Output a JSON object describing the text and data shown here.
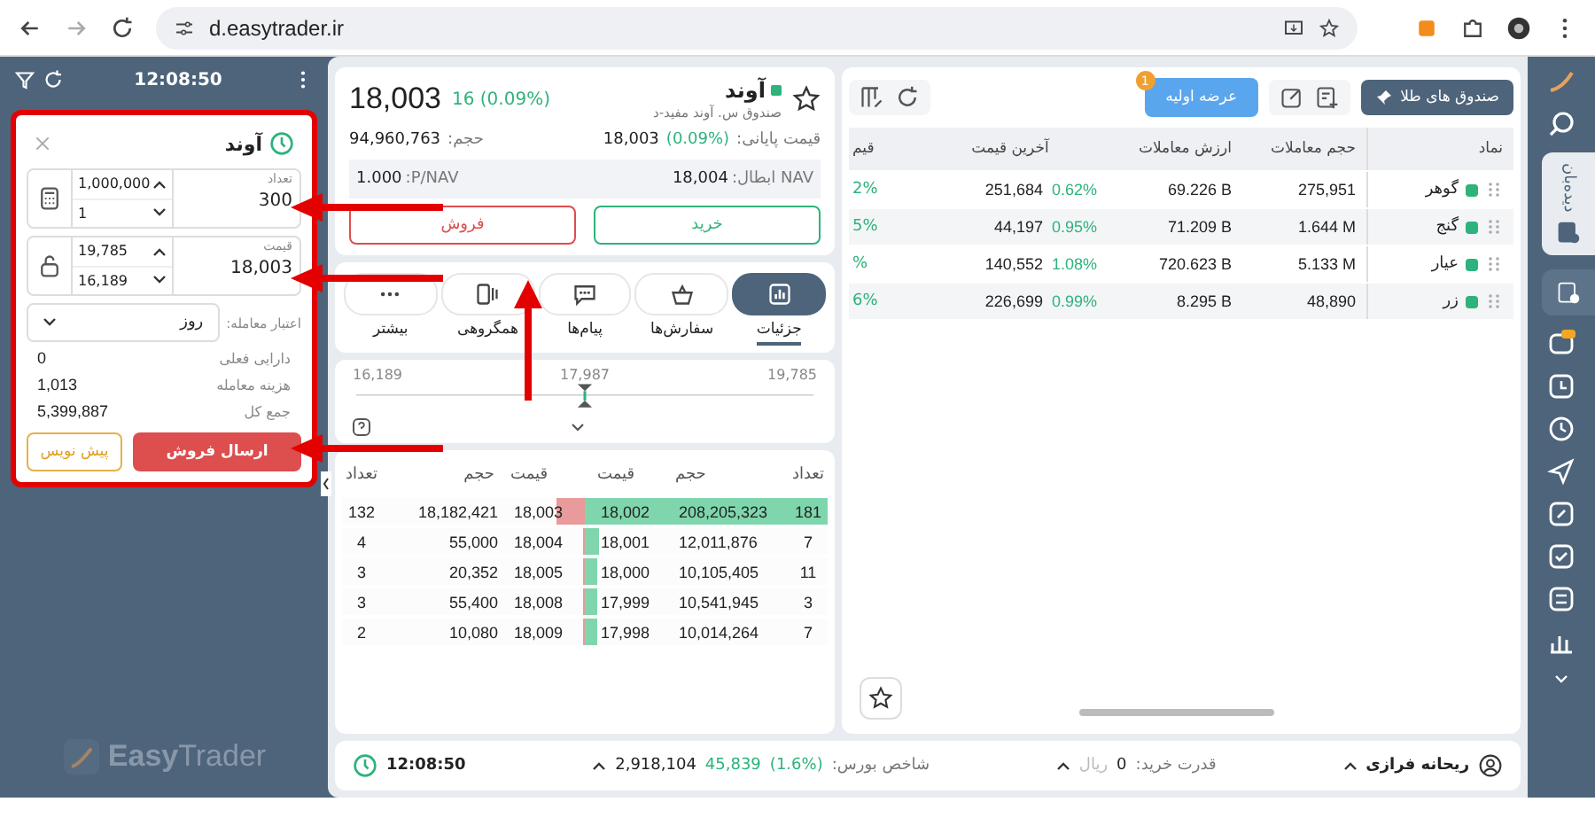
{
  "browser": {
    "url": "d.easytrader.ir"
  },
  "order_panel": {
    "time": "12:08:50",
    "title": "آوند",
    "fields": [
      {
        "kind": "count",
        "label": "تعداد",
        "value": "300",
        "upper": "1,000,000",
        "lower": "1"
      },
      {
        "kind": "price",
        "label": "قیمت",
        "value": "18,003",
        "upper": "19,785",
        "lower": "16,189"
      }
    ],
    "validity": {
      "label": "اعتبار معامله:",
      "value": "روز"
    },
    "summary": [
      {
        "label": "دارایی فعلی",
        "value": "0"
      },
      {
        "label": "هزینه معامله",
        "value": "1,013"
      },
      {
        "label": "جمع کل",
        "value": "5,399,887"
      }
    ],
    "buttons": [
      {
        "kind": "send",
        "label": "ارسال فروش"
      },
      {
        "kind": "draft",
        "label": "پیش نویس"
      }
    ],
    "brand": {
      "bold": "Easy",
      "light": "Trader"
    }
  },
  "symbol": {
    "name": "آوند",
    "subtitle": "صندوق س. آوند مفید-د",
    "price": "18,003",
    "change": "16 (0.09%)",
    "stats": [
      {
        "label": "قیمت پایانی:",
        "change": "(0.09%)",
        "value": "18,003"
      },
      {
        "label": "حجم:",
        "value": "94,960,763"
      }
    ],
    "nav": [
      {
        "label": "NAV ابطال:",
        "value": "18,004"
      },
      {
        "label": "P/NAV:",
        "value": "1.000"
      }
    ],
    "actions": [
      {
        "kind": "buy",
        "label": "خرید"
      },
      {
        "kind": "sell",
        "label": "فروش"
      }
    ]
  },
  "tabs": [
    {
      "kind": "chart",
      "label": "جزئیات",
      "selected": true
    },
    {
      "kind": "basket",
      "label": "سفارش‌ها",
      "selected": false
    },
    {
      "kind": "chat",
      "label": "پیام‌ها",
      "selected": false
    },
    {
      "kind": "group",
      "label": "همگروهی",
      "selected": false
    },
    {
      "kind": "more",
      "label": "بیشتر",
      "selected": false
    }
  ],
  "range": {
    "low": "16,189",
    "mid": "17,987",
    "high": "19,785"
  },
  "order_book": {
    "columns": [
      "تعداد",
      "حجم",
      "قیمت",
      "قیمت",
      "حجم",
      "تعداد"
    ],
    "rows": [
      {
        "buy": {
          "count": "181",
          "volume": "208,205,323",
          "price": "18,002",
          "level": 1.0
        },
        "sell": {
          "price": "18,003",
          "volume": "18,182,421",
          "count": "132",
          "level": 0.12
        }
      },
      {
        "buy": {
          "count": "7",
          "volume": "12,011,876",
          "price": "18,001",
          "level": 0.06
        },
        "sell": {
          "price": "18,004",
          "volume": "55,000",
          "count": "4",
          "level": 0.01
        }
      },
      {
        "buy": {
          "count": "11",
          "volume": "10,105,405",
          "price": "18,000",
          "level": 0.05
        },
        "sell": {
          "price": "18,005",
          "volume": "20,352",
          "count": "3",
          "level": 0.01
        }
      },
      {
        "buy": {
          "count": "3",
          "volume": "10,541,945",
          "price": "17,999",
          "level": 0.05
        },
        "sell": {
          "price": "18,008",
          "volume": "55,400",
          "count": "3",
          "level": 0.01
        }
      },
      {
        "buy": {
          "count": "7",
          "volume": "10,014,264",
          "price": "17,998",
          "level": 0.05
        },
        "sell": {
          "price": "18,009",
          "volume": "10,080",
          "count": "2",
          "level": 0.01
        }
      }
    ]
  },
  "watchlist": {
    "group": "صندوق های طلا",
    "ipo": {
      "label": "عرضه اولیه",
      "badge": "1"
    },
    "columns": [
      "نماد",
      "حجم معاملات",
      "ارزش معاملات",
      "آخرین قیمت",
      "قیم"
    ],
    "rows": [
      {
        "name": "گوهر",
        "volume": "275,951",
        "value": "69.226 B",
        "price": "251,684",
        "change": "0.62%",
        "column_5": "2%"
      },
      {
        "name": "گنج",
        "volume": "1.644 M",
        "value": "71.209 B",
        "price": "44,197",
        "change": "0.95%",
        "column_5": "5%"
      },
      {
        "name": "عیار",
        "volume": "5.133 M",
        "value": "720.623 B",
        "price": "140,552",
        "change": "1.08%",
        "column_5": "%"
      },
      {
        "name": "زر",
        "volume": "48,890",
        "value": "8.295 B",
        "price": "226,699",
        "change": "0.99%",
        "column_5": "6%"
      }
    ]
  },
  "status_bar": {
    "user": "ریحانه فرازی",
    "power_label": "قدرت خرید:",
    "power_value": "0",
    "power_unit": "ریال",
    "index_label": "شاخص بورس:",
    "index_change": "(1.6%)",
    "index_delta": "45,839",
    "index_value": "2,918,104",
    "time": "12:08:50"
  },
  "sidebar": {
    "tabs": [
      {
        "label": "دیده‌بان",
        "selected": true
      },
      {
        "selected": false
      }
    ]
  }
}
